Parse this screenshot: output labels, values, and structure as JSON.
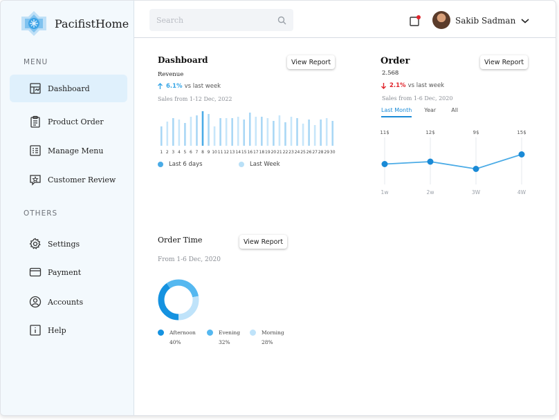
{
  "brand": {
    "name": "PacifistHome"
  },
  "sidebar": {
    "menu_title": "MENU",
    "others_title": "OTHERS",
    "menu_items": [
      {
        "label": "Dashboard",
        "icon": "dashboard-icon",
        "active": true
      },
      {
        "label": "Product Order",
        "icon": "clipboard-icon"
      },
      {
        "label": "Manage Menu",
        "icon": "list-icon"
      },
      {
        "label": "Customer Review",
        "icon": "star-chat-icon"
      }
    ],
    "other_items": [
      {
        "label": "Settings",
        "icon": "gear-icon"
      },
      {
        "label": "Payment",
        "icon": "card-icon"
      },
      {
        "label": "Accounts",
        "icon": "user-circle-icon"
      },
      {
        "label": "Help",
        "icon": "info-icon"
      }
    ]
  },
  "header": {
    "search_placeholder": "Search",
    "user_name": "Sakib Sadman",
    "notification_dot_color": "#e0242b"
  },
  "dashboard_card": {
    "title": "Dashboard",
    "button": "View Report",
    "subtitle": "Revenue",
    "change_pct": "6.1%",
    "change_text": "vs last week",
    "change_color": "#37a6e6",
    "range_text": "Sales from 1-12 Dec, 2022",
    "legend": [
      {
        "label": "Last 6 days",
        "color": "#4aabe6"
      },
      {
        "label": "Last Week",
        "color": "#b9e0f7"
      }
    ]
  },
  "order_card": {
    "title": "Order",
    "button": "View Report",
    "value": "2.568",
    "change_pct": "2.1%",
    "change_text": "vs last week",
    "change_color": "#e0242b",
    "range_text": "Sales from 1-6 Dec, 2020",
    "tabs": [
      {
        "label": "Last Month",
        "active": true
      },
      {
        "label": "Year"
      },
      {
        "label": "All"
      }
    ]
  },
  "order_time_card": {
    "title": "Order Time",
    "button": "View Report",
    "range_text": "From 1-6 Dec, 2020",
    "legend": [
      {
        "label": "Afternoon",
        "pct": "40%",
        "color": "#1592e0"
      },
      {
        "label": "Evening",
        "pct": "32%",
        "color": "#55b8f0"
      },
      {
        "label": "Morning",
        "pct": "28%",
        "color": "#bfe3fa"
      }
    ]
  },
  "chart_data": [
    {
      "type": "bar",
      "title": "Revenue",
      "categories": [
        "1",
        "2",
        "3",
        "4",
        "5",
        "6",
        "7",
        "8",
        "9",
        "10",
        "11",
        "12",
        "13",
        "14",
        "15",
        "16",
        "17",
        "18",
        "19",
        "20",
        "21",
        "22",
        "23",
        "24",
        "25",
        "26",
        "27",
        "28",
        "29",
        "30"
      ],
      "series": [
        {
          "name": "Last 6 days",
          "values": [
            0,
            0,
            0,
            0,
            0,
            0,
            0,
            50,
            0,
            0,
            0,
            0,
            0,
            0,
            0,
            0,
            0,
            0,
            0,
            0,
            0,
            0,
            0,
            0,
            0,
            0,
            0,
            0,
            0,
            0
          ]
        },
        {
          "name": "Last Week",
          "values": [
            28,
            35,
            40,
            38,
            33,
            42,
            44,
            0,
            46,
            28,
            40,
            40,
            40,
            42,
            38,
            48,
            42,
            42,
            40,
            36,
            44,
            34,
            42,
            40,
            32,
            38,
            30,
            38,
            40,
            36
          ]
        }
      ],
      "bar_colors": [
        "#a9d7f5",
        "#c7e6fa",
        "#a9d7f5",
        "#c7e6fa",
        "#a9d7f5",
        "#c7e6fa",
        "#a9d7f5",
        "#4aabe6",
        "#a9d7f5",
        "#c7e6fa",
        "#a9d7f5",
        "#c7e6fa",
        "#a9d7f5",
        "#c7e6fa",
        "#a9d7f5",
        "#a9d7f5",
        "#c7e6fa",
        "#a9d7f5",
        "#c7e6fa",
        "#a9d7f5",
        "#c7e6fa",
        "#a9d7f5",
        "#c7e6fa",
        "#a9d7f5",
        "#c7e6fa",
        "#a9d7f5",
        "#c7e6fa",
        "#a9d7f5",
        "#c7e6fa",
        "#a9d7f5"
      ],
      "ylim": [
        0,
        50
      ]
    },
    {
      "type": "line",
      "categories": [
        "1w",
        "2w",
        "3W",
        "4W"
      ],
      "values": [
        11,
        12,
        9,
        15
      ],
      "value_labels": [
        "11$",
        "12$",
        "9$",
        "15$"
      ],
      "color": "#1a8ad6",
      "ylim": [
        0,
        30
      ]
    },
    {
      "type": "pie",
      "donut": true,
      "labels": [
        "Afternoon",
        "Evening",
        "Morning"
      ],
      "values": [
        40,
        32,
        28
      ],
      "colors": [
        "#1592e0",
        "#55b8f0",
        "#bfe3fa"
      ]
    }
  ]
}
